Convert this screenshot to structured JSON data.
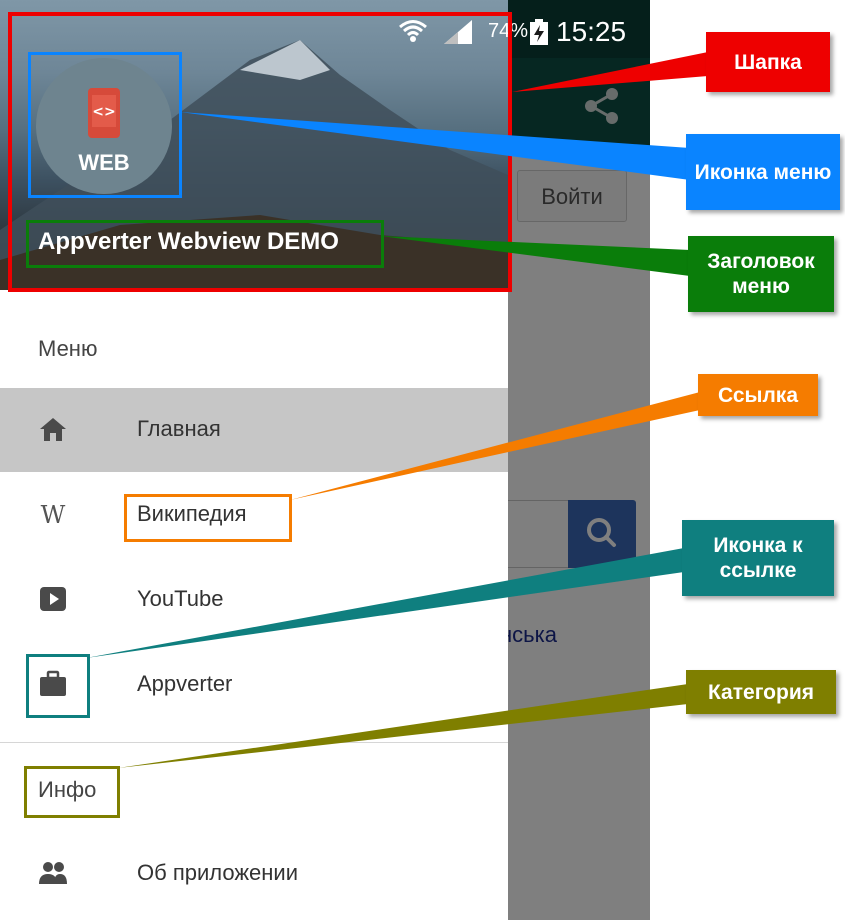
{
  "status_bar": {
    "battery_pct": "74%",
    "time": "15:25"
  },
  "app": {
    "login_label": "Войти",
    "partial_text": "нська"
  },
  "drawer": {
    "header_title": "Appverter Webview DEMO",
    "avatar_label": "WEB",
    "sections": [
      {
        "category": "Меню",
        "items": [
          {
            "label": "Главная",
            "icon": "home-icon",
            "active": true
          },
          {
            "label": "Википедия",
            "icon": "wikipedia-icon"
          },
          {
            "label": "YouTube",
            "icon": "youtube-icon"
          },
          {
            "label": "Appverter",
            "icon": "briefcase-icon"
          }
        ]
      },
      {
        "category": "Инфо",
        "items": [
          {
            "label": "Об приложении",
            "icon": "people-icon"
          }
        ]
      }
    ]
  },
  "annotations": {
    "header": {
      "label": "Шапка",
      "color": "#ee0000"
    },
    "menu_icon": {
      "label": "Иконка меню",
      "color": "#0a84ff"
    },
    "menu_title": {
      "label": "Заголовок меню",
      "color": "#0a7d0a"
    },
    "link": {
      "label": "Ссылка",
      "color": "#f57c00"
    },
    "link_icon": {
      "label": "Иконка к ссылке",
      "color": "#0f7f7f"
    },
    "category": {
      "label": "Категория",
      "color": "#7f7f00"
    }
  }
}
